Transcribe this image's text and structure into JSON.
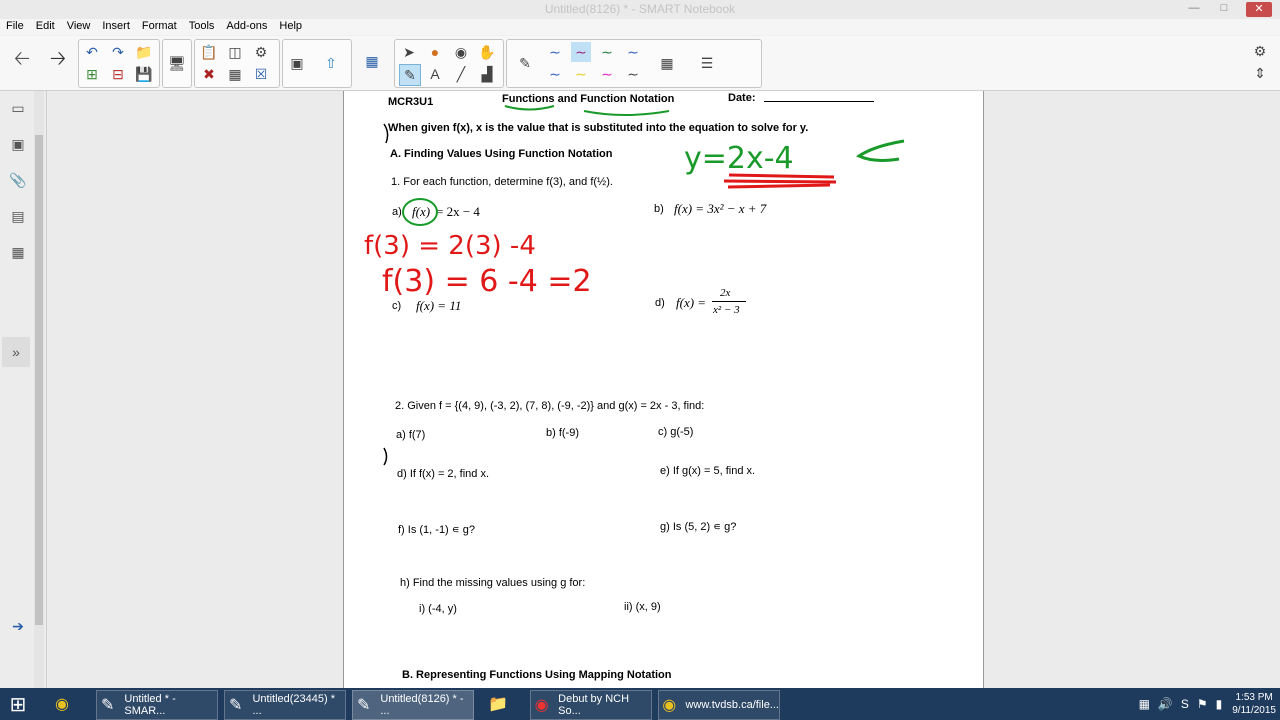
{
  "window": {
    "title": "Untitled(8126) * - SMART Notebook"
  },
  "menu": [
    "File",
    "Edit",
    "View",
    "Insert",
    "Format",
    "Tools",
    "Add-ons",
    "Help"
  ],
  "worksheet": {
    "course": "MCR3U1",
    "heading": "Functions and Function Notation",
    "date_label": "Date:",
    "intro": "When given f(x), x is the value that is substituted into the equation to solve for y.",
    "section_a": "A.   Finding Values Using Function Notation",
    "q1": "1.   For each function, determine f(3), and f(½).",
    "q1a_label": "a)",
    "q1a_fx": "f(x)",
    "q1a_rhs": "= 2x − 4",
    "q1b_label": "b)",
    "q1b": "f(x) = 3x² − x + 7",
    "q1c_label": "c)",
    "q1c": "f(x) = 11",
    "q1d_label": "d)",
    "q1d_lhs": "f(x) =",
    "q1d_num": "2x",
    "q1d_den": "x² − 3",
    "q2": "2.   Given f = {(4, 9), (-3, 2), (7, 8), (-9, -2)} and g(x) = 2x - 3, find:",
    "q2a": "a)   f(7)",
    "q2b": "b)   f(-9)",
    "q2c": "c)   g(-5)",
    "q2d": "d)   If f(x) = 2, find x.",
    "q2e": "e)   If g(x) = 5, find x.",
    "q2f": "f)   Is (1, -1) ∊ g?",
    "q2g": "g)   Is (5, 2) ∊ g?",
    "q2h": "h)   Find the missing values using g for:",
    "q2hi": "i)   (-4, y)",
    "q2hii": "ii)   (x, 9)",
    "section_b": "B.   Representing Functions Using Mapping Notation"
  },
  "handwriting": {
    "green_eq": "y=2x-4",
    "red_line1": "f(3) = 2(3) -4",
    "red_line2": "f(3) = 6 -4 =2"
  },
  "colors": {
    "ink_green": "#1a9a2a",
    "ink_red": "#e01818",
    "taskbar": "#1e3a5c"
  },
  "taskbar": {
    "items": [
      {
        "label": "Untitled * - SMAR..."
      },
      {
        "label": "Untitled(23445) * ..."
      },
      {
        "label": "Untitled(8126) * - ..."
      },
      {
        "label": "Debut by NCH So..."
      },
      {
        "label": "www.tvdsb.ca/file..."
      }
    ],
    "time": "1:53 PM",
    "date": "9/11/2015"
  }
}
